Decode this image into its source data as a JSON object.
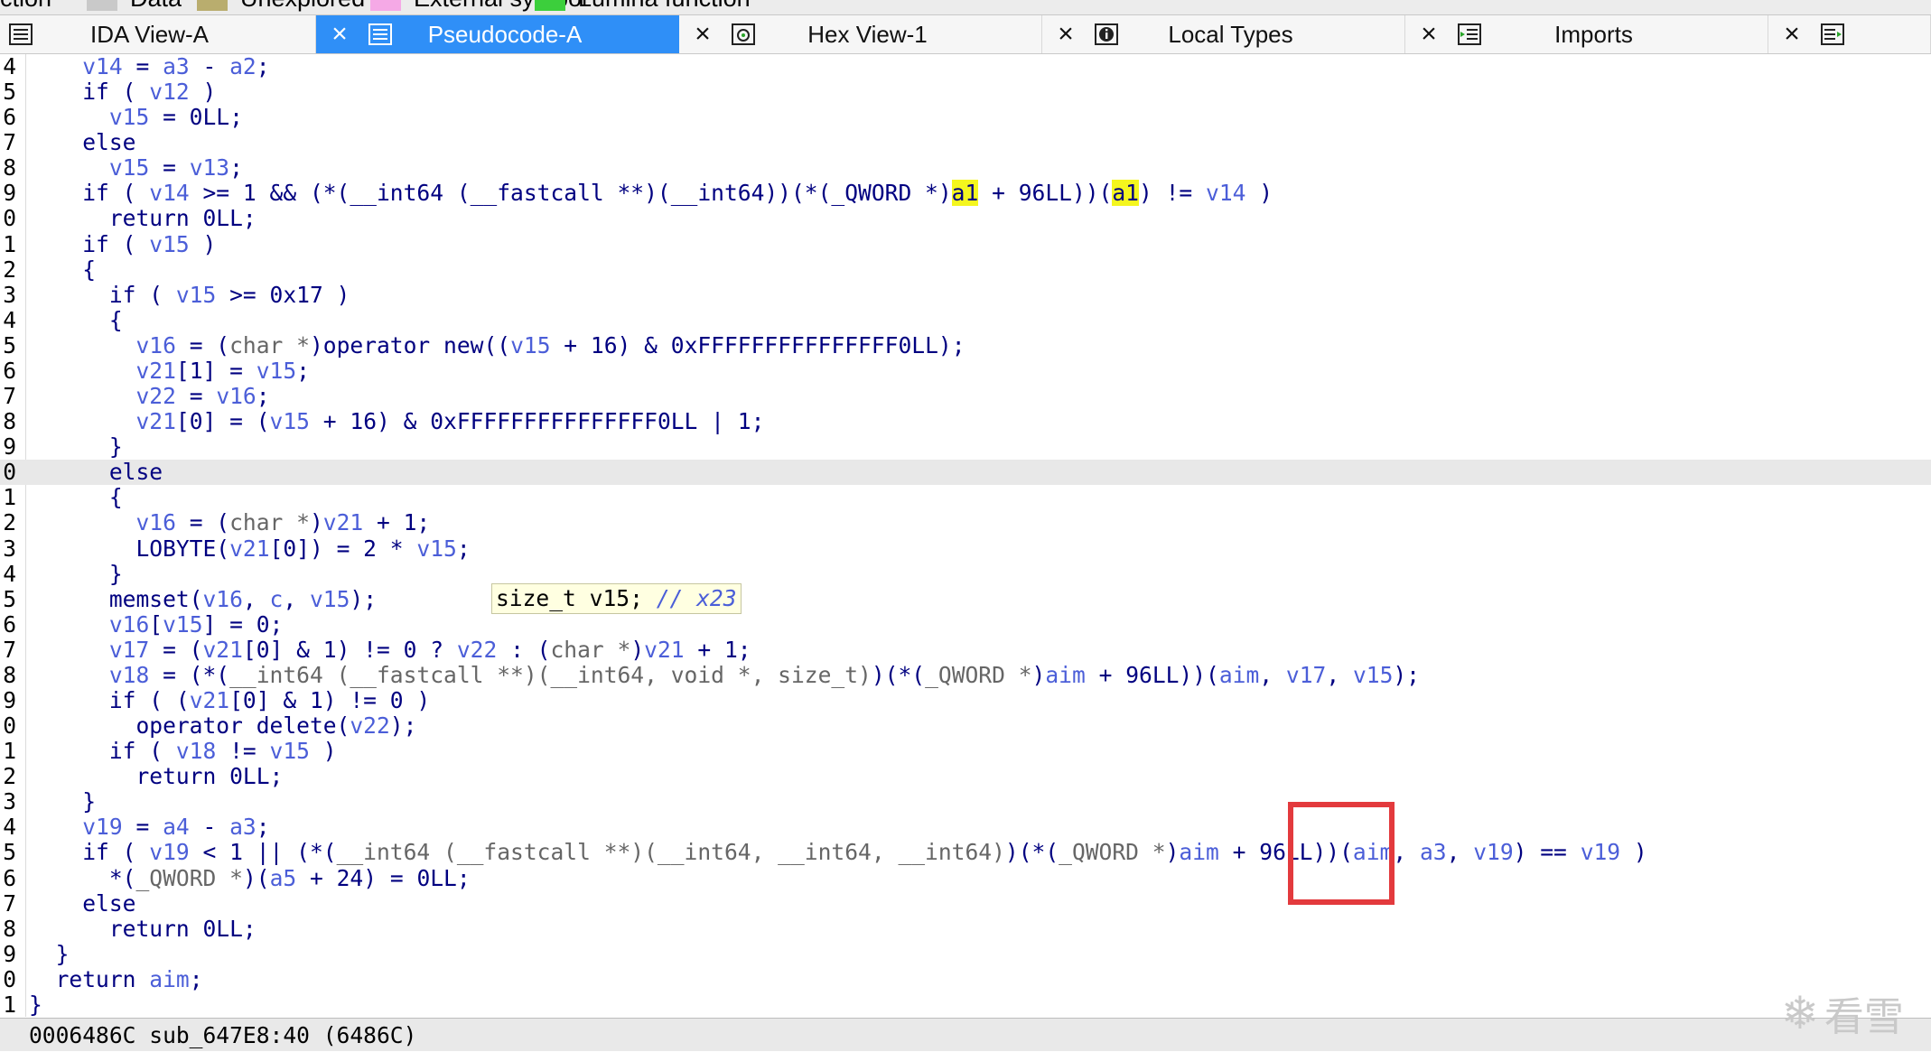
{
  "legend": [
    {
      "label": "ction",
      "color": ""
    },
    {
      "label": "Data",
      "color": "#c9c9c9"
    },
    {
      "label": "Unexplored",
      "color": "#b9ad6e"
    },
    {
      "label": "External symbol",
      "color": "#f5a9e6"
    },
    {
      "label": "Lumina function",
      "color": "#3ccf3c"
    }
  ],
  "tabs": [
    {
      "label": "IDA View-A",
      "icon": "document-list-icon",
      "active": false
    },
    {
      "label": "Pseudocode-A",
      "icon": "document-list-icon",
      "active": true
    },
    {
      "label": "Hex View-1",
      "icon": "hex-view-icon",
      "active": false
    },
    {
      "label": "Local Types",
      "icon": "info-icon",
      "active": false
    },
    {
      "label": "Imports",
      "icon": "imports-icon",
      "active": false
    },
    {
      "label": "",
      "icon": "exports-icon",
      "active": false
    }
  ],
  "close_glyph": "×",
  "code_lines": [
    {
      "n": "4",
      "tokens": [
        [
          "    ",
          ""
        ],
        [
          "v14",
          "v"
        ],
        [
          " = ",
          ""
        ],
        [
          "a3",
          "v"
        ],
        [
          " - ",
          ""
        ],
        [
          "a2",
          "v"
        ],
        [
          ";",
          ""
        ]
      ]
    },
    {
      "n": "5",
      "tokens": [
        [
          "    if ( ",
          ""
        ],
        [
          "v12",
          "v"
        ],
        [
          " )",
          ""
        ]
      ]
    },
    {
      "n": "6",
      "tokens": [
        [
          "      ",
          ""
        ],
        [
          "v15",
          "v"
        ],
        [
          " = 0LL;",
          ""
        ]
      ]
    },
    {
      "n": "7",
      "tokens": [
        [
          "    else",
          ""
        ]
      ]
    },
    {
      "n": "8",
      "tokens": [
        [
          "      ",
          ""
        ],
        [
          "v15",
          "v"
        ],
        [
          " = ",
          ""
        ],
        [
          "v13",
          "v"
        ],
        [
          ";",
          ""
        ]
      ]
    },
    {
      "n": "9",
      "tokens": [
        [
          "    if ( ",
          ""
        ],
        [
          "v14",
          "v"
        ],
        [
          " >= 1 && (*(__int64 (__fastcall **)(__int64))(*(_QWORD *)",
          ""
        ],
        [
          "a1",
          "hl"
        ],
        [
          " + 96LL))(",
          ""
        ],
        [
          "a1",
          "hl"
        ],
        [
          ") != ",
          ""
        ],
        [
          "v14",
          "v"
        ],
        [
          " )",
          ""
        ]
      ]
    },
    {
      "n": "0",
      "tokens": [
        [
          "      return 0LL;",
          ""
        ]
      ]
    },
    {
      "n": "1",
      "tokens": [
        [
          "    if ( ",
          ""
        ],
        [
          "v15",
          "v"
        ],
        [
          " )",
          ""
        ]
      ]
    },
    {
      "n": "2",
      "tokens": [
        [
          "    {",
          ""
        ]
      ]
    },
    {
      "n": "3",
      "tokens": [
        [
          "      if ( ",
          ""
        ],
        [
          "v15",
          "v"
        ],
        [
          " >= 0x17 )",
          ""
        ]
      ]
    },
    {
      "n": "4",
      "tokens": [
        [
          "      {",
          ""
        ]
      ]
    },
    {
      "n": "5",
      "tokens": [
        [
          "        ",
          ""
        ],
        [
          "v16",
          "v"
        ],
        [
          " = (",
          ""
        ],
        [
          "char *",
          "t"
        ],
        [
          ")operator new((",
          ""
        ],
        [
          "v15",
          "v"
        ],
        [
          " + 16) & 0xFFFFFFFFFFFFFFF0LL);",
          ""
        ]
      ]
    },
    {
      "n": "6",
      "tokens": [
        [
          "        ",
          ""
        ],
        [
          "v21",
          "v"
        ],
        [
          "[1] = ",
          ""
        ],
        [
          "v15",
          "v"
        ],
        [
          ";",
          ""
        ]
      ]
    },
    {
      "n": "7",
      "tokens": [
        [
          "        ",
          ""
        ],
        [
          "v22",
          "v"
        ],
        [
          " = ",
          ""
        ],
        [
          "v16",
          "v"
        ],
        [
          ";",
          ""
        ]
      ]
    },
    {
      "n": "8",
      "tokens": [
        [
          "        ",
          ""
        ],
        [
          "v21",
          "v"
        ],
        [
          "[0] = (",
          ""
        ],
        [
          "v15",
          "v"
        ],
        [
          " + 16) & 0xFFFFFFFFFFFFFFF0LL | 1;",
          ""
        ]
      ]
    },
    {
      "n": "9",
      "tokens": [
        [
          "      }",
          ""
        ]
      ]
    },
    {
      "n": "0",
      "tokens": [
        [
          "      else",
          ""
        ]
      ],
      "current": true
    },
    {
      "n": "1",
      "tokens": [
        [
          "      {",
          ""
        ]
      ]
    },
    {
      "n": "2",
      "tokens": [
        [
          "        ",
          ""
        ],
        [
          "v16",
          "v"
        ],
        [
          " = (",
          ""
        ],
        [
          "char *",
          "t"
        ],
        [
          ")",
          ""
        ],
        [
          "v21",
          "v"
        ],
        [
          " + 1;",
          ""
        ]
      ]
    },
    {
      "n": "3",
      "tokens": [
        [
          "        LOBYTE(",
          ""
        ],
        [
          "v21",
          "v"
        ],
        [
          "[0]) = 2 * ",
          ""
        ],
        [
          "v15",
          "v"
        ],
        [
          ";",
          ""
        ]
      ]
    },
    {
      "n": "4",
      "tokens": [
        [
          "      }",
          ""
        ]
      ]
    },
    {
      "n": "5",
      "tokens": [
        [
          "      memset(",
          ""
        ],
        [
          "v16",
          "v"
        ],
        [
          ", ",
          ""
        ],
        [
          "c",
          "v"
        ],
        [
          ", ",
          ""
        ],
        [
          "v15",
          "v"
        ],
        [
          ");",
          ""
        ]
      ]
    },
    {
      "n": "6",
      "tokens": [
        [
          "      ",
          ""
        ],
        [
          "v16",
          "v"
        ],
        [
          "[",
          ""
        ],
        [
          "v15",
          "v"
        ],
        [
          "] = 0;",
          ""
        ]
      ]
    },
    {
      "n": "7",
      "tokens": [
        [
          "      ",
          ""
        ],
        [
          "v17",
          "v"
        ],
        [
          " = (",
          ""
        ],
        [
          "v21",
          "v"
        ],
        [
          "[0] & 1) != 0 ? ",
          ""
        ],
        [
          "v22",
          "v"
        ],
        [
          " : (",
          ""
        ],
        [
          "char *",
          "t"
        ],
        [
          ")",
          ""
        ],
        [
          "v21",
          "v"
        ],
        [
          " + 1;",
          ""
        ]
      ]
    },
    {
      "n": "8",
      "tokens": [
        [
          "      ",
          ""
        ],
        [
          "v18",
          "v"
        ],
        [
          " = (*(",
          ""
        ],
        [
          "__int64 (__fastcall **)(__int64, void *, size_t)",
          "t"
        ],
        [
          ")(*(",
          ""
        ],
        [
          "_QWORD *",
          "t"
        ],
        [
          ")",
          ""
        ],
        [
          "aim",
          "v"
        ],
        [
          " + 96LL))(",
          ""
        ],
        [
          "aim",
          "v"
        ],
        [
          ", ",
          ""
        ],
        [
          "v17",
          "v"
        ],
        [
          ", ",
          ""
        ],
        [
          "v15",
          "v"
        ],
        [
          ");",
          ""
        ]
      ]
    },
    {
      "n": "9",
      "tokens": [
        [
          "      if ( (",
          ""
        ],
        [
          "v21",
          "v"
        ],
        [
          "[0] & 1) != 0 )",
          ""
        ]
      ]
    },
    {
      "n": "0",
      "tokens": [
        [
          "        operator delete(",
          ""
        ],
        [
          "v22",
          "v"
        ],
        [
          ");",
          ""
        ]
      ]
    },
    {
      "n": "1",
      "tokens": [
        [
          "      if ( ",
          ""
        ],
        [
          "v18",
          "v"
        ],
        [
          " != ",
          ""
        ],
        [
          "v15",
          "v"
        ],
        [
          " )",
          ""
        ]
      ]
    },
    {
      "n": "2",
      "tokens": [
        [
          "        return 0LL;",
          ""
        ]
      ]
    },
    {
      "n": "3",
      "tokens": [
        [
          "    }",
          ""
        ]
      ]
    },
    {
      "n": "4",
      "tokens": [
        [
          "    ",
          ""
        ],
        [
          "v19",
          "v"
        ],
        [
          " = ",
          ""
        ],
        [
          "a4",
          "v"
        ],
        [
          " - ",
          ""
        ],
        [
          "a3",
          "v"
        ],
        [
          ";",
          ""
        ]
      ]
    },
    {
      "n": "5",
      "tokens": [
        [
          "    if ( ",
          ""
        ],
        [
          "v19",
          "v"
        ],
        [
          " < 1 || (*(",
          ""
        ],
        [
          "__int64 (__fastcall **)(__int64, __int64, __int64)",
          "t"
        ],
        [
          ")(*(",
          ""
        ],
        [
          "_QWORD *",
          "t"
        ],
        [
          ")",
          ""
        ],
        [
          "aim",
          "v"
        ],
        [
          " + 96LL))(",
          ""
        ],
        [
          "aim",
          "v"
        ],
        [
          ", ",
          ""
        ],
        [
          "a3",
          "v"
        ],
        [
          ", ",
          ""
        ],
        [
          "v19",
          "v"
        ],
        [
          ") == ",
          ""
        ],
        [
          "v19",
          "v"
        ],
        [
          " )",
          ""
        ]
      ]
    },
    {
      "n": "6",
      "tokens": [
        [
          "      *(",
          ""
        ],
        [
          "_QWORD *",
          "t"
        ],
        [
          ")(",
          ""
        ],
        [
          "a5",
          "v"
        ],
        [
          " + 24) = 0LL;",
          ""
        ]
      ]
    },
    {
      "n": "7",
      "tokens": [
        [
          "    else",
          ""
        ]
      ]
    },
    {
      "n": "8",
      "tokens": [
        [
          "      return 0LL;",
          ""
        ]
      ]
    },
    {
      "n": "9",
      "tokens": [
        [
          "  }",
          ""
        ]
      ]
    },
    {
      "n": "0",
      "tokens": [
        [
          "  return ",
          ""
        ],
        [
          "aim",
          "v"
        ],
        [
          ";",
          ""
        ]
      ]
    },
    {
      "n": "1",
      "tokens": [
        [
          "}",
          ""
        ]
      ]
    }
  ],
  "hint": {
    "decl": "size_t v15; ",
    "comment": "// x23"
  },
  "status": {
    "text": "0006486C sub_647E8:40 (6486C)"
  },
  "watermark": {
    "glyph": "❄",
    "text": "看雪"
  },
  "colors": {
    "accent": "#2f8ff7",
    "highlight": "#f4f61e",
    "annotation": "#e33a3d",
    "keyword": "#000080",
    "variable": "#4b5ed8",
    "type": "#666666"
  }
}
